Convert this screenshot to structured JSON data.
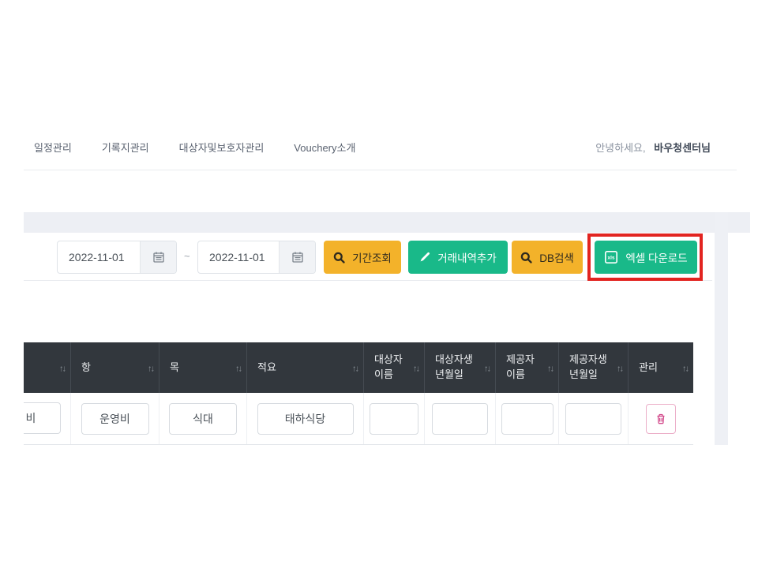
{
  "nav": {
    "items": [
      {
        "label": "일정관리"
      },
      {
        "label": "기록지관리"
      },
      {
        "label": "대상자및보호자관리"
      },
      {
        "label": "Vouchery소개"
      }
    ],
    "greeting": "안녕하세요,",
    "username": "바우청센터님"
  },
  "filter": {
    "date_from": "2022-11-01",
    "date_to": "2022-11-01",
    "separator": "~",
    "period_search_label": "기간조회",
    "add_transaction_label": "거래내역추가",
    "db_search_label": "DB검색",
    "excel_download_label": "엑셀 다운로드"
  },
  "icons": {
    "sort": "↑↓"
  },
  "table": {
    "columns": [
      {
        "label": "",
        "sortable": true
      },
      {
        "label": "항",
        "sortable": true
      },
      {
        "label": "목",
        "sortable": true
      },
      {
        "label": "적요",
        "sortable": true
      },
      {
        "label": "대상자 이름",
        "sortable": true
      },
      {
        "label": "대상자생 년월일",
        "sortable": true
      },
      {
        "label": "제공자 이름",
        "sortable": true
      },
      {
        "label": "제공자생 년월일",
        "sortable": true
      },
      {
        "label": "관리",
        "sortable": true
      }
    ],
    "rows": [
      {
        "col0_partial": "비",
        "hang": "운영비",
        "mok": "식대",
        "jeokyo": "태하식당",
        "target_name": "",
        "target_birth": "",
        "provider_name": "",
        "provider_birth": ""
      }
    ]
  },
  "annotation": {
    "type": "highlight-box",
    "target": "excel-download-button"
  },
  "colors": {
    "accent_yellow": "#f3b22a",
    "accent_green": "#19b989",
    "table_header_bg": "#32373d",
    "danger_pink": "#d2488a",
    "highlight_red": "#e22420",
    "band_gray": "#edeff4"
  }
}
